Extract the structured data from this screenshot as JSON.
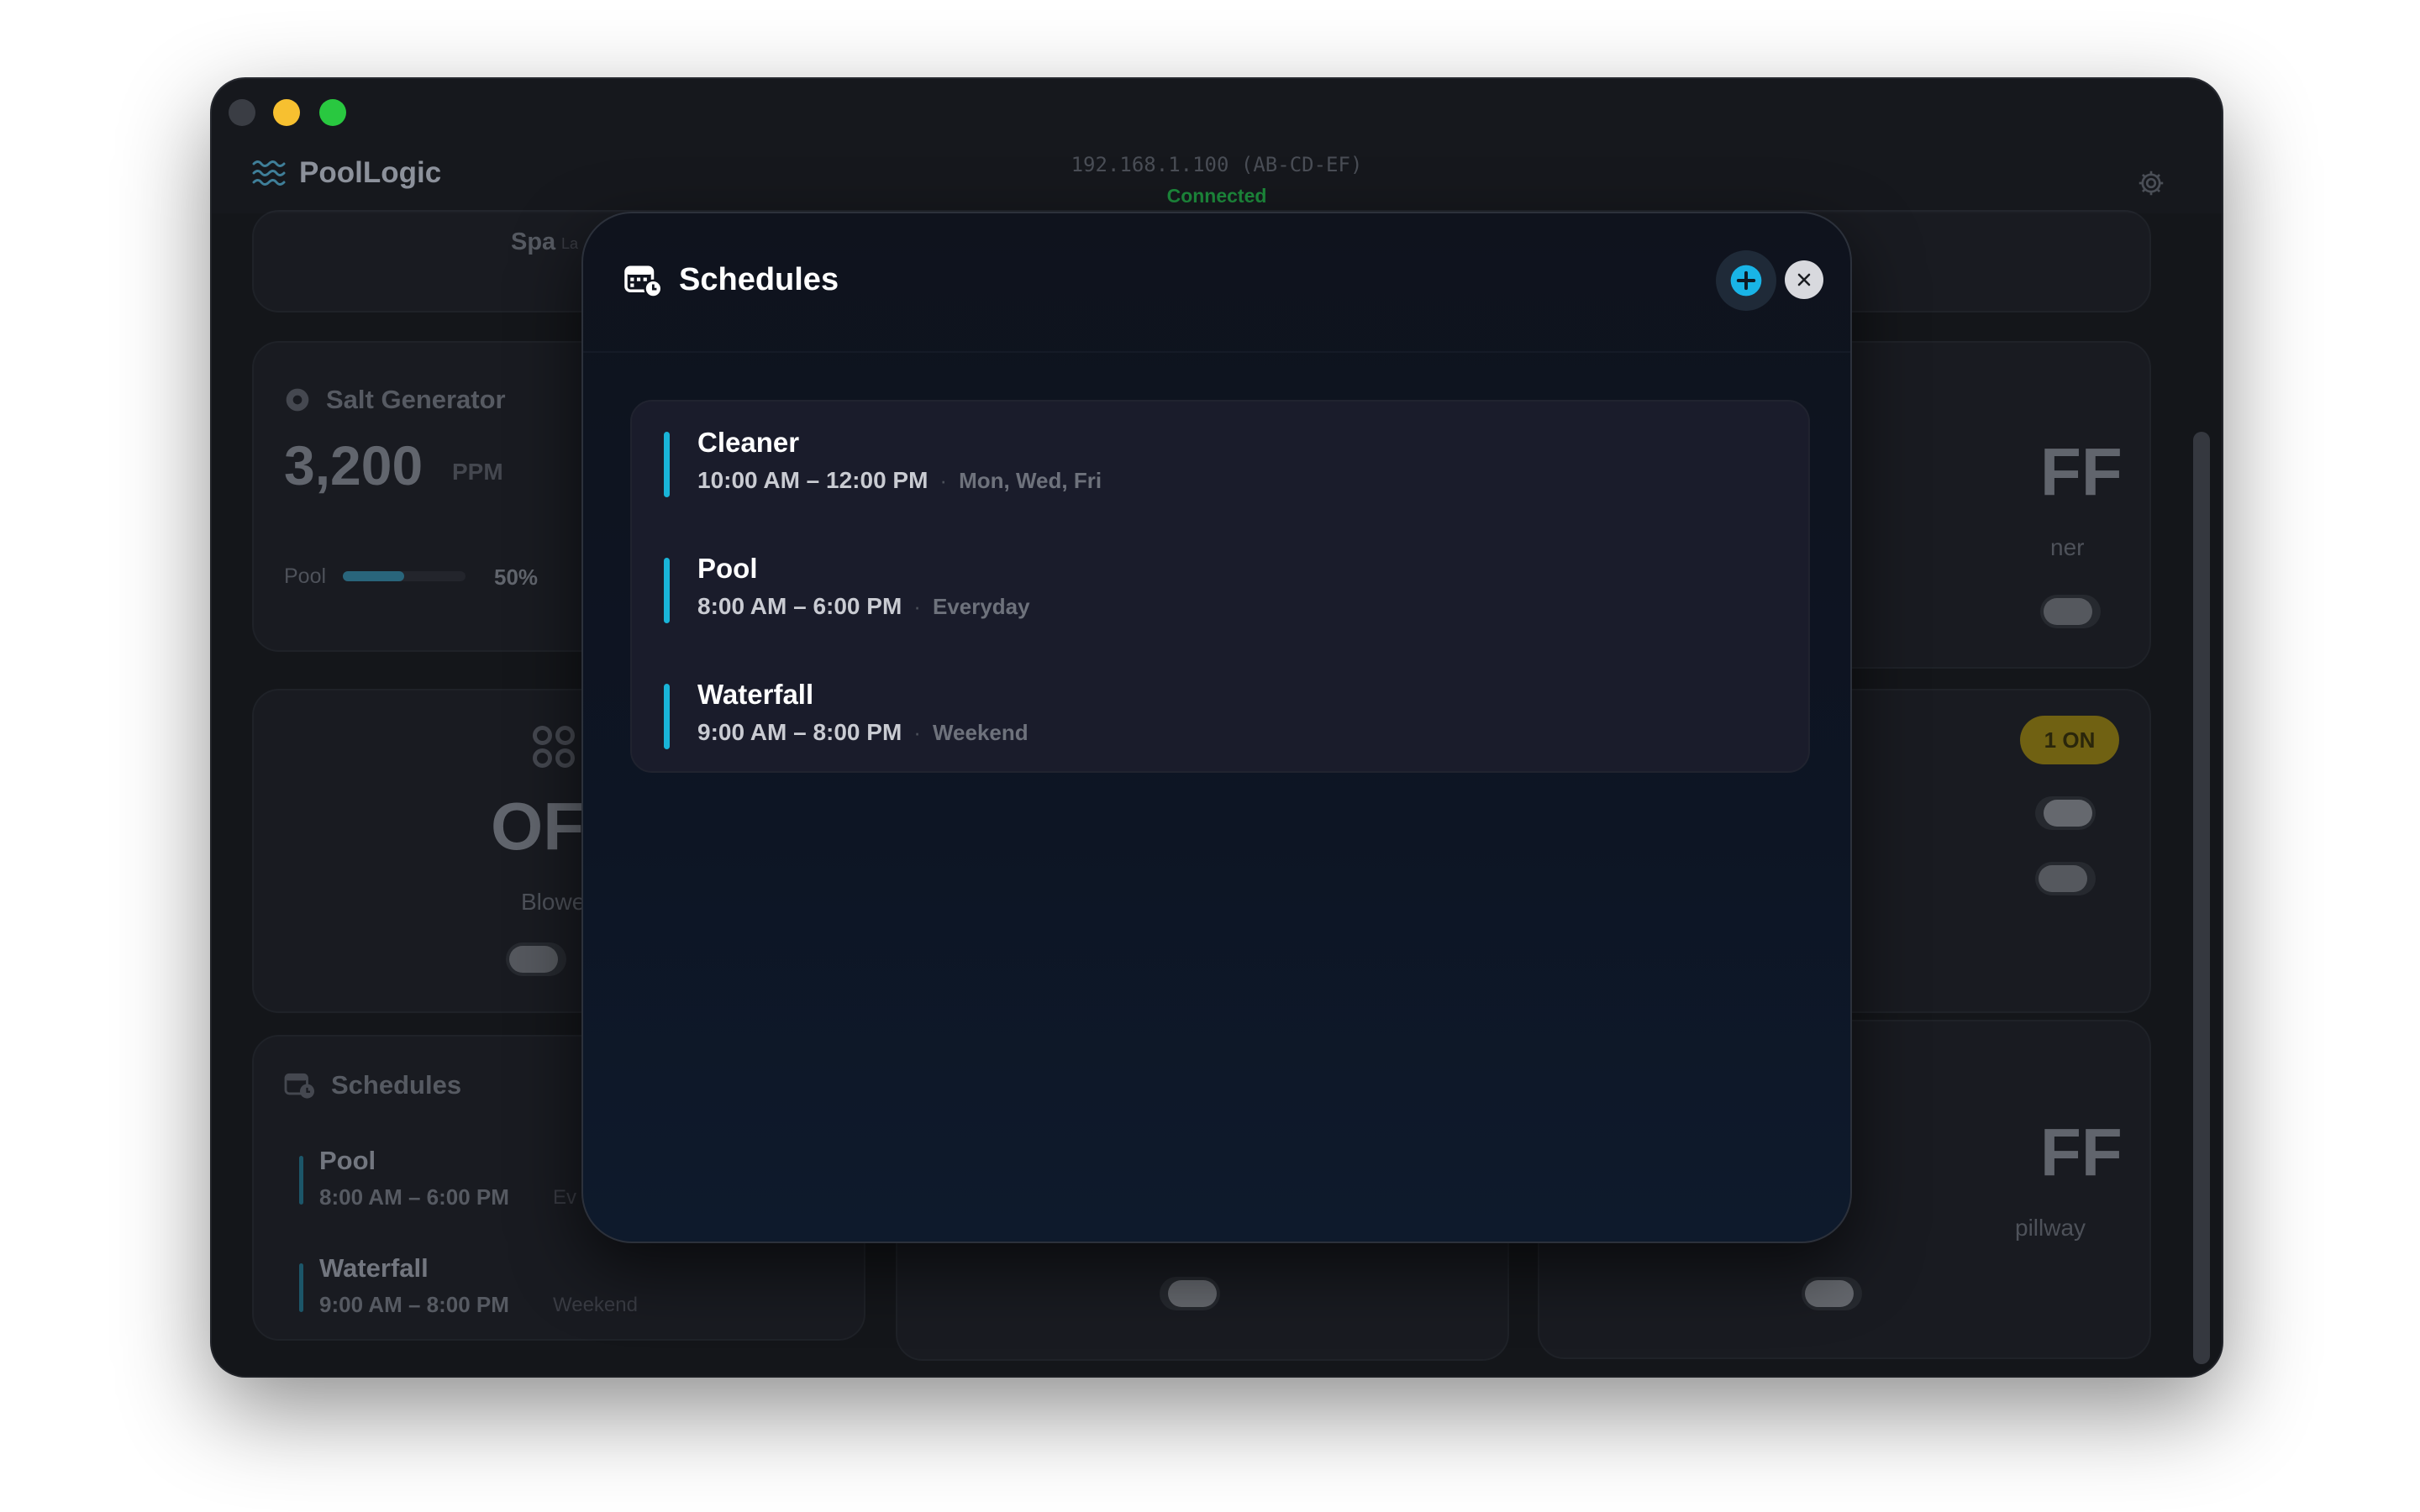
{
  "app": {
    "title": "PoolLogic",
    "connection_address": "192.168.1.100 (AB-CD-EF)",
    "connection_status": "Connected"
  },
  "background": {
    "spa_label": "Spa",
    "spa_label_cut": "La",
    "salt": {
      "title": "Salt Generator",
      "value": "3,200",
      "unit": "PPM",
      "pool_label": "Pool",
      "pool_percent": "50%",
      "pool_fraction": 0.5,
      "next_label_cut": "S"
    },
    "right_top": {
      "value_cut": "FF",
      "label_cut": "ner"
    },
    "blower": {
      "value_cut": "OF",
      "label_cut": "Blowe"
    },
    "lights": {
      "badge": "1 ON"
    },
    "right_bottom": {
      "value_cut": "FF",
      "label_cut": "pillway"
    },
    "schedules_card": {
      "title": "Schedules",
      "items": [
        {
          "name": "Pool",
          "time": "8:00 AM – 6:00 PM",
          "days_cut": "Ev"
        },
        {
          "name": "Waterfall",
          "time": "9:00 AM – 8:00 PM",
          "days": "Weekend"
        }
      ]
    }
  },
  "modal": {
    "title": "Schedules",
    "icons": {
      "header": "calendar-clock-icon",
      "add": "plus-circle-icon",
      "close": "close-icon"
    },
    "accent": "#19b4d8",
    "items": [
      {
        "name": "Cleaner",
        "time": "10:00 AM – 12:00 PM",
        "separator": "·",
        "days": "Mon, Wed, Fri"
      },
      {
        "name": "Pool",
        "time": "8:00 AM – 6:00 PM",
        "separator": "·",
        "days": "Everyday"
      },
      {
        "name": "Waterfall",
        "time": "9:00 AM – 8:00 PM",
        "separator": "·",
        "days": "Weekend"
      }
    ]
  }
}
